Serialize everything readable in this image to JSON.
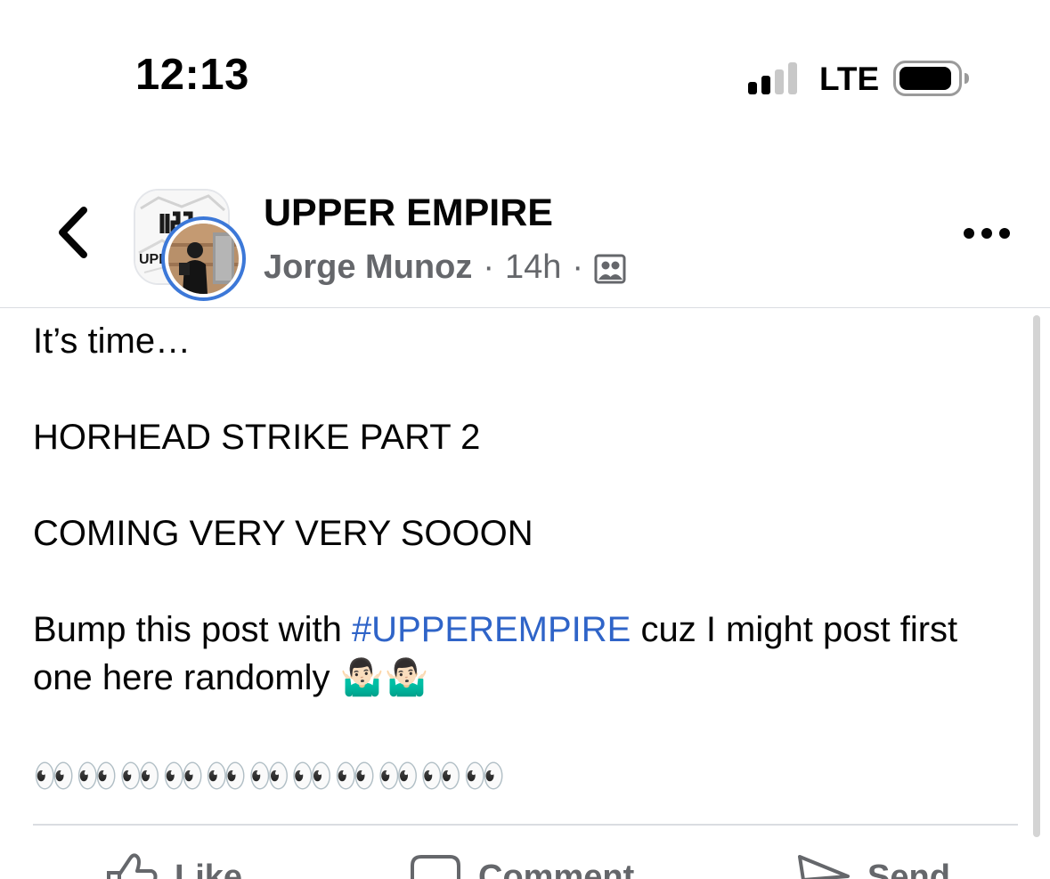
{
  "status_bar": {
    "time": "12:13",
    "network": "LTE",
    "icons": [
      "signal-icon",
      "battery-icon"
    ]
  },
  "header": {
    "group_name": "UPPER EMPIRE",
    "author": "Jorge Munoz",
    "separator": "·",
    "timestamp": "14h",
    "icons": [
      "back-chevron-icon",
      "group-avatar",
      "user-avatar",
      "audience-group-icon",
      "more-options-icon"
    ]
  },
  "post": {
    "line1": "It’s time…",
    "line2": "HORHEAD STRIKE PART 2",
    "line3": "COMING VERY VERY SOOON",
    "line4_before": "Bump this post with ",
    "hashtag": "#UPPEREMPIRE",
    "line4_after": " cuz I might post first one here randomly 🤷🏻‍♂️🤷🏻‍♂️",
    "eyes": "👀👀👀👀👀👀👀👀👀👀👀"
  },
  "actions": {
    "like": "Like",
    "comment": "Comment",
    "send": "Send"
  },
  "colors": {
    "link": "#2f64c8",
    "meta_gray": "#65676b",
    "story_ring": "#3c78d8",
    "divider": "#dadde1"
  }
}
